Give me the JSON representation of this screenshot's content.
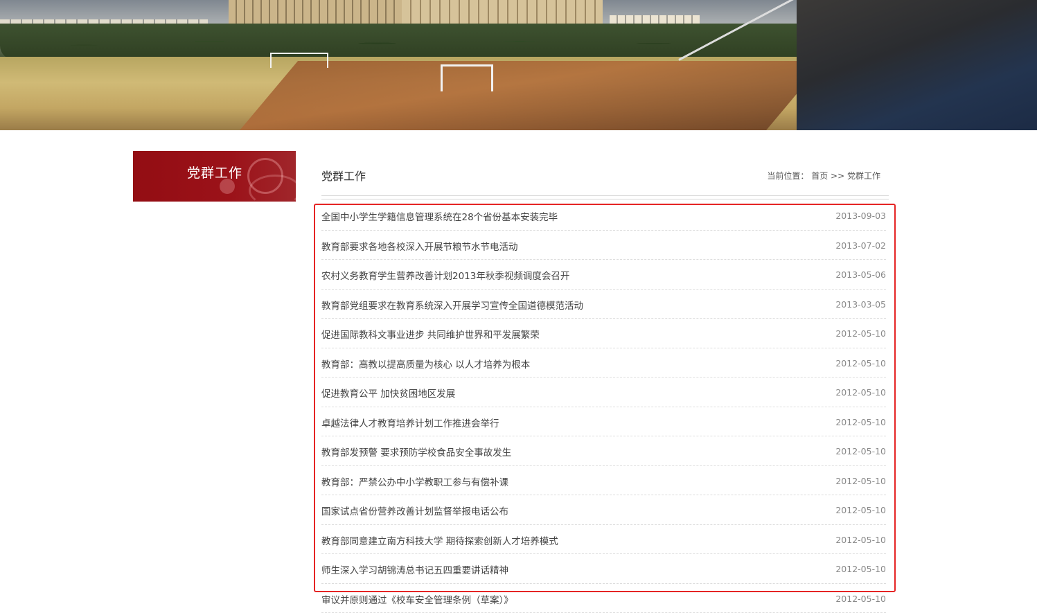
{
  "sidebar": {
    "title": "党群工作"
  },
  "main": {
    "title": "党群工作",
    "breadcrumb": {
      "prefix": "当前位置：",
      "home": "首页",
      "separator": ">>",
      "current": "党群工作"
    }
  },
  "articles": [
    {
      "title": "全国中小学生学籍信息管理系统在28个省份基本安装完毕",
      "date": "2013-09-03"
    },
    {
      "title": "教育部要求各地各校深入开展节粮节水节电活动",
      "date": "2013-07-02"
    },
    {
      "title": "农村义务教育学生营养改善计划2013年秋季视频调度会召开",
      "date": "2013-05-06"
    },
    {
      "title": "教育部党组要求在教育系统深入开展学习宣传全国道德模范活动",
      "date": "2013-03-05"
    },
    {
      "title": "促进国际教科文事业进步 共同维护世界和平发展繁荣",
      "date": "2012-05-10"
    },
    {
      "title": "教育部：高教以提高质量为核心 以人才培养为根本",
      "date": "2012-05-10"
    },
    {
      "title": "促进教育公平 加快贫困地区发展",
      "date": "2012-05-10"
    },
    {
      "title": "卓越法律人才教育培养计划工作推进会举行",
      "date": "2012-05-10"
    },
    {
      "title": "教育部发预警 要求预防学校食品安全事故发生",
      "date": "2012-05-10"
    },
    {
      "title": "教育部：严禁公办中小学教职工参与有偿补课",
      "date": "2012-05-10"
    },
    {
      "title": "国家试点省份营养改善计划监督举报电话公布",
      "date": "2012-05-10"
    },
    {
      "title": "教育部同意建立南方科技大学 期待探索创新人才培养模式",
      "date": "2012-05-10"
    },
    {
      "title": "师生深入学习胡锦涛总书记五四重要讲话精神",
      "date": "2012-05-10"
    },
    {
      "title": "审议并原则通过《校车安全管理条例（草案）》",
      "date": "2012-05-10"
    }
  ],
  "colors": {
    "accent": "#9b1219",
    "highlight_border": "#e52424"
  }
}
